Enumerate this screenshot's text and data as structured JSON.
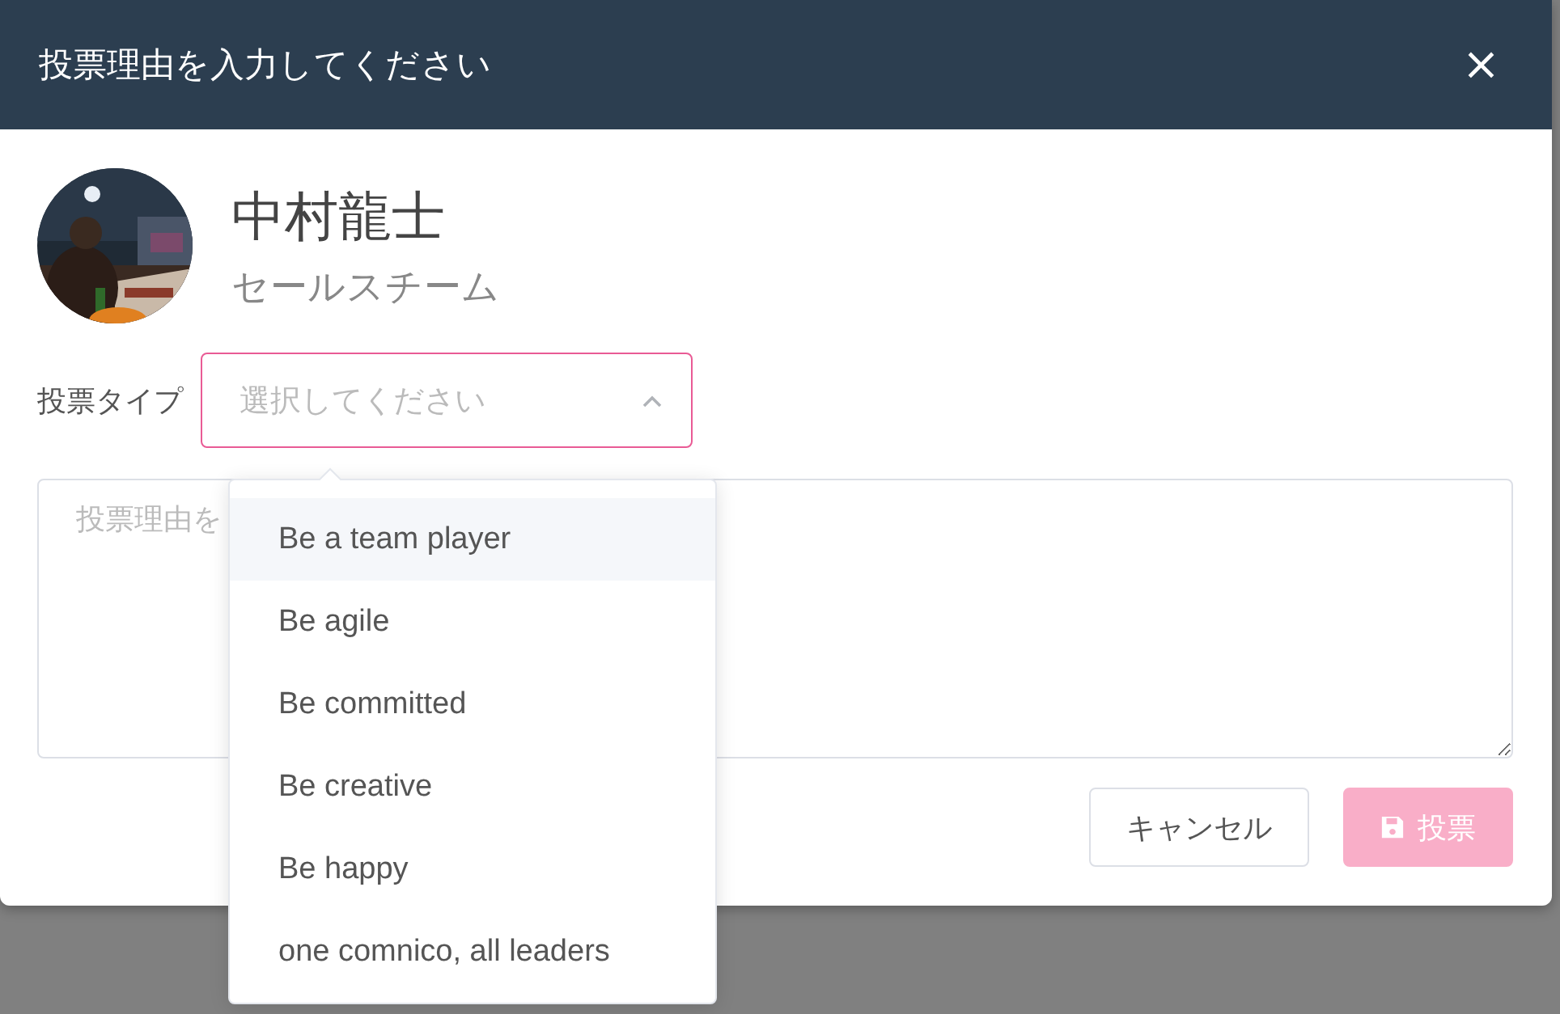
{
  "modal": {
    "title": "投票理由を入力してください",
    "close": "×"
  },
  "user": {
    "name": "中村龍士",
    "team": "セールスチーム"
  },
  "vote_type": {
    "label": "投票タイプ",
    "placeholder": "選択してください",
    "expanded": true,
    "options": [
      {
        "label": "Be a team player",
        "highlighted": true
      },
      {
        "label": "Be agile",
        "highlighted": false
      },
      {
        "label": "Be committed",
        "highlighted": false
      },
      {
        "label": "Be creative",
        "highlighted": false
      },
      {
        "label": "Be happy",
        "highlighted": false
      },
      {
        "label": "one comnico, all leaders",
        "highlighted": false
      }
    ]
  },
  "reason": {
    "placeholder": "投票理由を"
  },
  "buttons": [
    {
      "kind": "cancel",
      "label": "キャンセル",
      "disabled": false
    },
    {
      "kind": "submit",
      "label": "投票",
      "disabled": true
    }
  ]
}
